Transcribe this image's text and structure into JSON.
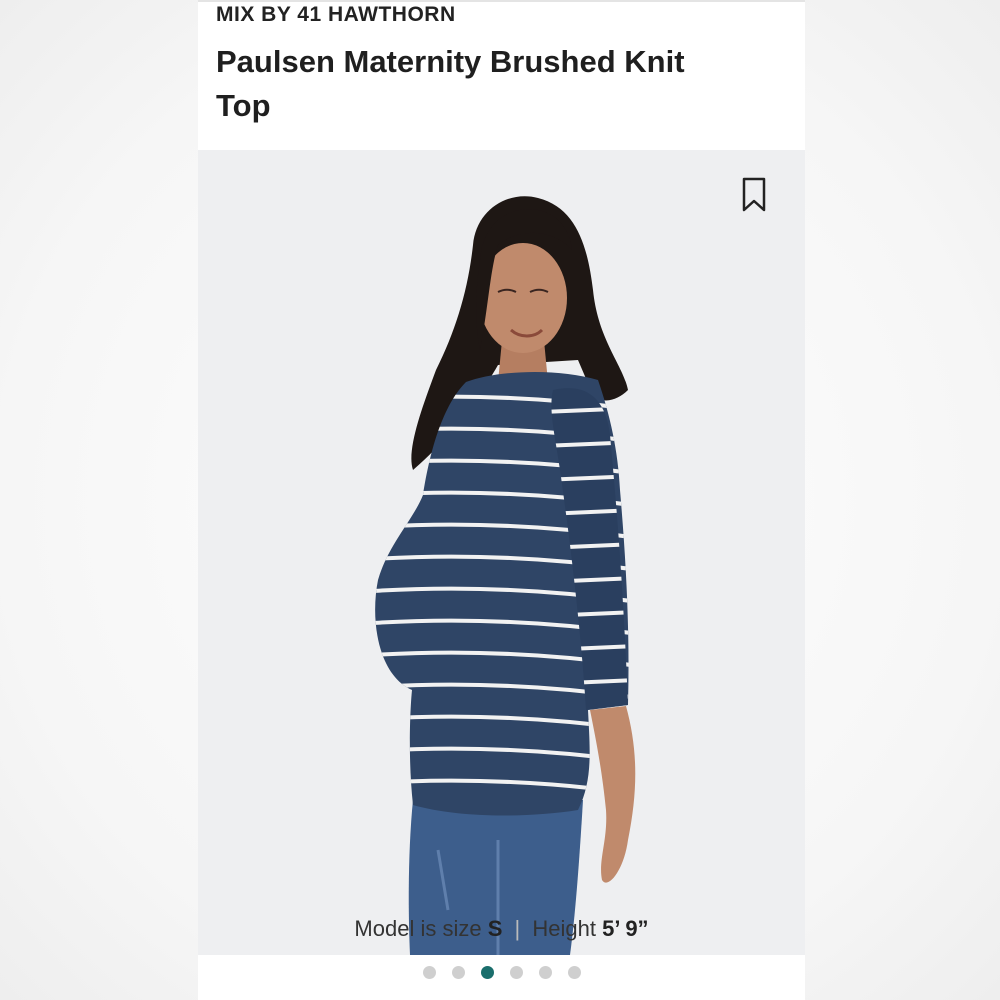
{
  "product": {
    "brand": "MIX BY 41 HAWTHORN",
    "title": "Paulsen Maternity Brushed Knit Top"
  },
  "image": {
    "caption": {
      "prefix": "Model is size",
      "size": "S",
      "separator": "|",
      "height_label": "Height",
      "height_value": "5’ 9”"
    },
    "bookmark_icon": "bookmark-icon"
  },
  "carousel": {
    "count": 6,
    "active_index": 2
  },
  "colors": {
    "accent": "#1a6e6c",
    "shirt": "#2f4566",
    "stripe": "#f2f2f2",
    "jeans": "#3d5e8c"
  }
}
